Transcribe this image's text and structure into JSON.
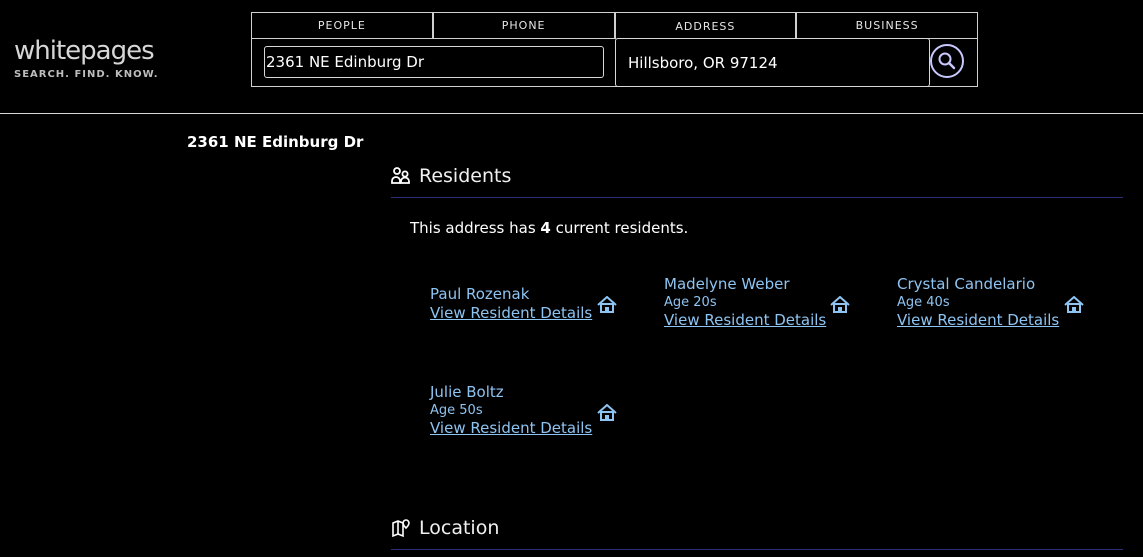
{
  "logo": {
    "word": "whitepages",
    "tagline": "SEARCH. FIND. KNOW."
  },
  "search": {
    "tabs": [
      "PEOPLE",
      "PHONE",
      "ADDRESS",
      "BUSINESS"
    ],
    "address_value": "2361 NE Edinburg Dr",
    "city_value": "Hillsboro, OR 97124"
  },
  "page": {
    "address_title": "2361 NE Edinburg Dr"
  },
  "residents_section": {
    "heading": "Residents",
    "intro_prefix": "This address has",
    "intro_count": "4",
    "intro_suffix": "current residents.",
    "items": [
      {
        "name": "Paul Rozenak",
        "age": "",
        "link": "View Resident Details"
      },
      {
        "name": "Madelyne Weber",
        "age": "Age 20s",
        "link": "View Resident Details"
      },
      {
        "name": "Crystal Candelario",
        "age": "Age 40s",
        "link": "View Resident Details"
      },
      {
        "name": "Julie Boltz",
        "age": "Age 50s",
        "link": "View Resident Details"
      }
    ]
  },
  "location_section": {
    "heading": "Location"
  },
  "colors": {
    "link": "#8ec4f2",
    "rule": "#2b2f77",
    "background": "#000000"
  }
}
